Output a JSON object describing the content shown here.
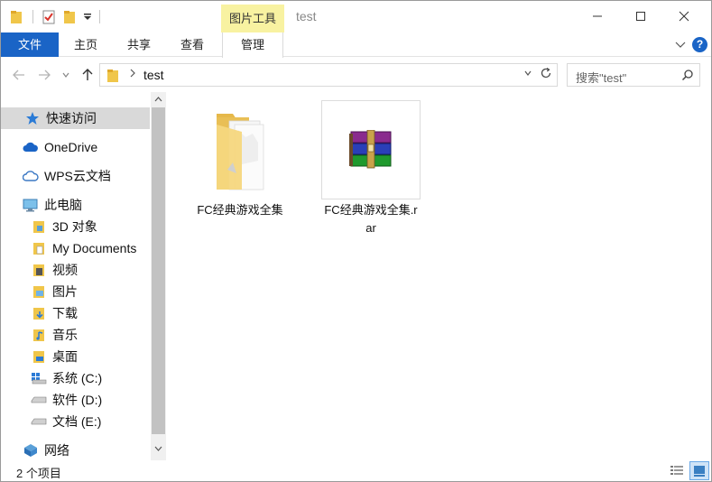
{
  "titlebar": {
    "tools_tab_label": "图片工具",
    "title": "test"
  },
  "ribbon": {
    "tabs": [
      {
        "label": "文件"
      },
      {
        "label": "主页"
      },
      {
        "label": "共享"
      },
      {
        "label": "查看"
      },
      {
        "label": "管理"
      }
    ],
    "help_label": "?"
  },
  "address": {
    "path": "test",
    "search_placeholder": "搜索\"test\""
  },
  "navpane": {
    "items": [
      {
        "label": "快速访问",
        "icon": "star-icon"
      },
      {
        "label": "OneDrive",
        "icon": "cloud-icon"
      },
      {
        "label": "WPS云文档",
        "icon": "wps-cloud-icon"
      },
      {
        "label": "此电脑",
        "icon": "computer-icon"
      },
      {
        "label": "3D 对象",
        "icon": "3d-objects-icon"
      },
      {
        "label": "My Documents",
        "icon": "documents-icon"
      },
      {
        "label": "视频",
        "icon": "video-icon"
      },
      {
        "label": "图片",
        "icon": "pictures-icon"
      },
      {
        "label": "下载",
        "icon": "download-icon"
      },
      {
        "label": "音乐",
        "icon": "music-icon"
      },
      {
        "label": "桌面",
        "icon": "desktop-icon"
      },
      {
        "label": "系统 (C:)",
        "icon": "system-drive-icon"
      },
      {
        "label": "软件 (D:)",
        "icon": "drive-icon"
      },
      {
        "label": "文档 (E:)",
        "icon": "drive-icon"
      },
      {
        "label": "网络",
        "icon": "network-icon"
      }
    ]
  },
  "files": [
    {
      "name": "FC经典游戏全集",
      "type": "folder"
    },
    {
      "name": "FC经典游戏全集.rar",
      "type": "rar-archive"
    }
  ],
  "status": {
    "item_count": "2 个项目"
  },
  "colors": {
    "accent": "#1a64c6",
    "tools_tab": "#f8f2a1",
    "selection": "#d9d9d9"
  }
}
